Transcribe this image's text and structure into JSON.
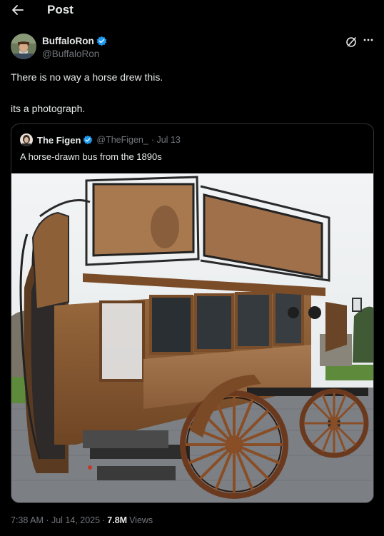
{
  "header": {
    "title": "Post",
    "back_icon": "arrow-left-icon"
  },
  "post": {
    "author_name": "BuffaloRon",
    "author_handle": "@BuffaloRon",
    "verified": true,
    "text_line_1": "There is no way a horse drew this.",
    "text_line_2": "its a photograph.",
    "timestamp": "7:38 AM · Jul 14, 2025",
    "separator": "·",
    "views_count": "7.8M",
    "views_label": "Views"
  },
  "quote": {
    "author_name": "The Figen",
    "author_handle": "@TheFigen_",
    "date": "· Jul 13",
    "text": "A horse-drawn bus from the 1890s",
    "image_subject": "horse-drawn double-decker omnibus photograph"
  },
  "colors": {
    "background": "#000000",
    "text_primary": "#e7e9ea",
    "text_secondary": "#71767b",
    "verified_blue": "#1d9bf0",
    "border": "#2f3336"
  }
}
